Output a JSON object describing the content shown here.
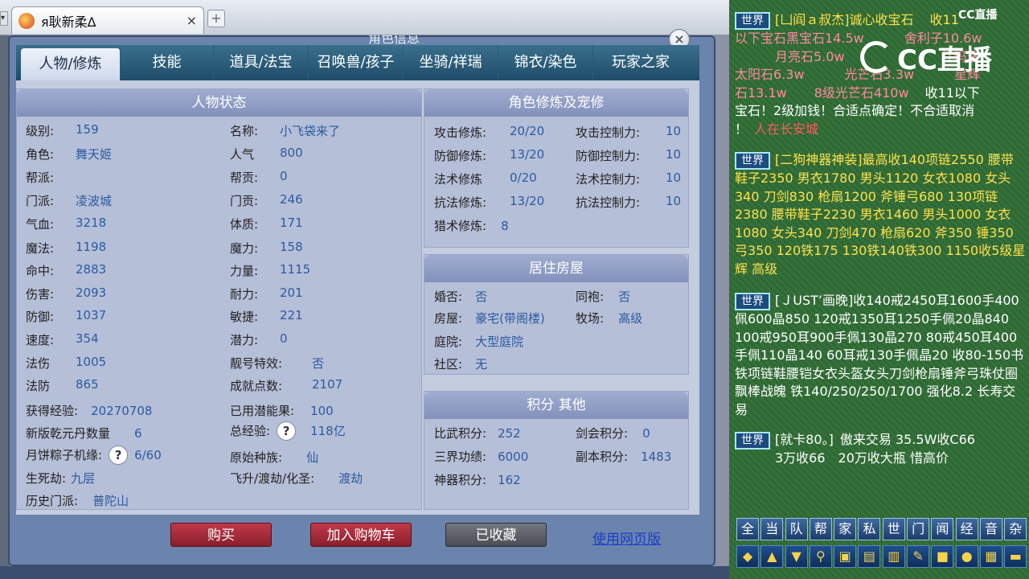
{
  "browser": {
    "tab_title": "я耿新柔Δ",
    "close": "×",
    "newtab": "+",
    "side": "▾"
  },
  "window": {
    "title": "角色信息",
    "close": "×"
  },
  "nav": {
    "tabs": [
      "人物/修炼",
      "技能",
      "道具/法宝",
      "召唤兽/孩子",
      "坐骑/祥瑞",
      "锦衣/染色",
      "玩家之家"
    ]
  },
  "status": {
    "head": "人物状态",
    "left": [
      {
        "k": "级别:",
        "v": "159"
      },
      {
        "k": "角色:",
        "v": "舞天姬"
      },
      {
        "k": "帮派:",
        "v": ""
      },
      {
        "k": "门派:",
        "v": "凌波城"
      },
      {
        "k": "气血:",
        "v": "3218"
      },
      {
        "k": "魔法:",
        "v": "1198"
      },
      {
        "k": "命中:",
        "v": "2883"
      },
      {
        "k": "伤害:",
        "v": "2093"
      },
      {
        "k": "防御:",
        "v": "1037"
      },
      {
        "k": "速度:",
        "v": "354"
      },
      {
        "k": "法伤",
        "v": "1005"
      },
      {
        "k": "法防",
        "v": "865"
      }
    ],
    "right": [
      {
        "k": "名称:",
        "v": "小飞袋来了"
      },
      {
        "k": "人气",
        "v": "800"
      },
      {
        "k": "帮贡:",
        "v": "0"
      },
      {
        "k": "门贡:",
        "v": "246"
      },
      {
        "k": "体质:",
        "v": "171"
      },
      {
        "k": "魔力:",
        "v": "158"
      },
      {
        "k": "力量:",
        "v": "1115"
      },
      {
        "k": "耐力:",
        "v": "201"
      },
      {
        "k": "敏捷:",
        "v": "221"
      },
      {
        "k": "潜力:",
        "v": "0"
      },
      {
        "k": "靓号特效:",
        "v": "否"
      },
      {
        "k": "成就点数:",
        "v": "2107"
      }
    ],
    "exp_k": "获得经验:",
    "exp_v": "20270708",
    "used_k": "已用潜能果:",
    "used_v": "100",
    "qian_k": "新版乾元丹数量",
    "qian_v": "6",
    "total_k": "总经验:",
    "total_q": "?",
    "total_v": "118亿",
    "moon_k": "月饼粽子机缘:",
    "moon_q": "?",
    "moon_v": "6/60",
    "race_k": "原始种族:",
    "race_v": "仙",
    "life_k": "生死劫:",
    "life_v": "九层",
    "fly_k": "飞升/渡劫/化圣:",
    "fly_v": "渡劫",
    "hist_k": "历史门派:",
    "hist_v": "普陀山"
  },
  "cultivation": {
    "head": "角色修炼及宠修",
    "rows": [
      {
        "a": "攻击修炼:",
        "av": "20/20",
        "b": "攻击控制力:",
        "bv": "10"
      },
      {
        "a": "防御修炼:",
        "av": "13/20",
        "b": "防御控制力:",
        "bv": "10"
      },
      {
        "a": "法术修炼",
        "av": "0/20",
        "b": "法术控制力:",
        "bv": "10"
      },
      {
        "a": "抗法修炼:",
        "av": "13/20",
        "b": "抗法控制力:",
        "bv": "10"
      }
    ],
    "hunt_k": "猎术修炼:",
    "hunt_v": "8"
  },
  "house": {
    "head": "居住房屋",
    "marry_k": "婚否:",
    "marry_v": "否",
    "robe_k": "同袍:",
    "robe_v": "否",
    "house_k": "房屋:",
    "house_v": "豪宅(带阁楼)",
    "ranch_k": "牧场:",
    "ranch_v": "高级",
    "yard_k": "庭院:",
    "yard_v": "大型庭院",
    "comm_k": "社区:",
    "comm_v": "无"
  },
  "points": {
    "head": "积分 其他",
    "pk_k": "比武积分:",
    "pk_v": "252",
    "sword_k": "剑会积分:",
    "sword_v": "0",
    "merit_k": "三界功绩:",
    "merit_v": "6000",
    "dungeon_k": "副本积分:",
    "dungeon_v": "1483",
    "beast_k": "神器积分:",
    "beast_v": "162"
  },
  "buttons": {
    "buy": "购买",
    "cart": "加入购物车",
    "fav": "已收藏",
    "web": "使用网页版"
  },
  "chat": {
    "cc_small": "CC直播",
    "cc_logo": "CC直播",
    "m1": {
      "badge": "世界",
      "name": "[凵阎ａ叔杰]",
      "text": "诚心收宝石",
      "extra1": "收11",
      "line2": "以下宝石黑宝石14.5w",
      "line2b": "舍利子10.6w",
      "line3": "月亮石5.0w",
      "line3b": "红玛瑙",
      "line4": "太阳石6.3w",
      "line4b": "光芒石3.3w",
      "line4c": "星辉",
      "line5": "石13.1w",
      "line5b": "8级光芒石410w",
      "line5c": "收11以下",
      "line6": "宝石！2级加钱！合适点确定！不合适取消",
      "line7": "！",
      "line7b": "人在长安城"
    },
    "m2": {
      "badge": "世界",
      "name": "[二狗神器神装]",
      "text": "最高收140项链2550 腰带鞋子2350 男衣1780 男头1120 女衣1080 女头340 刀剑830 枪扇1200 斧锤弓680 130项链2380 腰带鞋子2230 男衣1460 男头1000 女衣1080 女头340 刀剑470 枪扇620 斧350 锤350 弓350 120铁175 130铁140铁300 1150收5级星辉 高级"
    },
    "m3": {
      "badge": "世界",
      "name": "[ＪUST’画晚]",
      "text": "收140戒2450耳1600手400佩600晶850 120戒1350耳1250手佩20晶840 100戒950耳900手佩130晶270 80戒450耳400手佩110晶140 60耳戒130手佩晶20 收80-150书铁项链鞋腰铠女衣头盔女头刀剑枪扇锤斧弓珠仗圈飘棒战魄 铁140/250/250/1700 强化8.2 长寿交易"
    },
    "m4": {
      "badge": "世界",
      "name": "[就卡80。]",
      "text": "傲来交易 35.5W收C66",
      "line2": "3万收66　20万收大瓶 惜高价"
    },
    "channels": [
      "全",
      "当",
      "队",
      "帮",
      "家",
      "私",
      "世",
      "门",
      "闻",
      "经",
      "音",
      "杂"
    ],
    "tools": [
      "◆",
      "▲",
      "▼",
      "⚲",
      "▣",
      "▤",
      "▥",
      "✎",
      "■",
      "●",
      "▦",
      "▬"
    ]
  },
  "colors": {
    "accent": "#2a5aa0",
    "chat_bg": "#2f6b35",
    "btn_red": "#a02a33",
    "btn_gray": "#5c5f66"
  }
}
